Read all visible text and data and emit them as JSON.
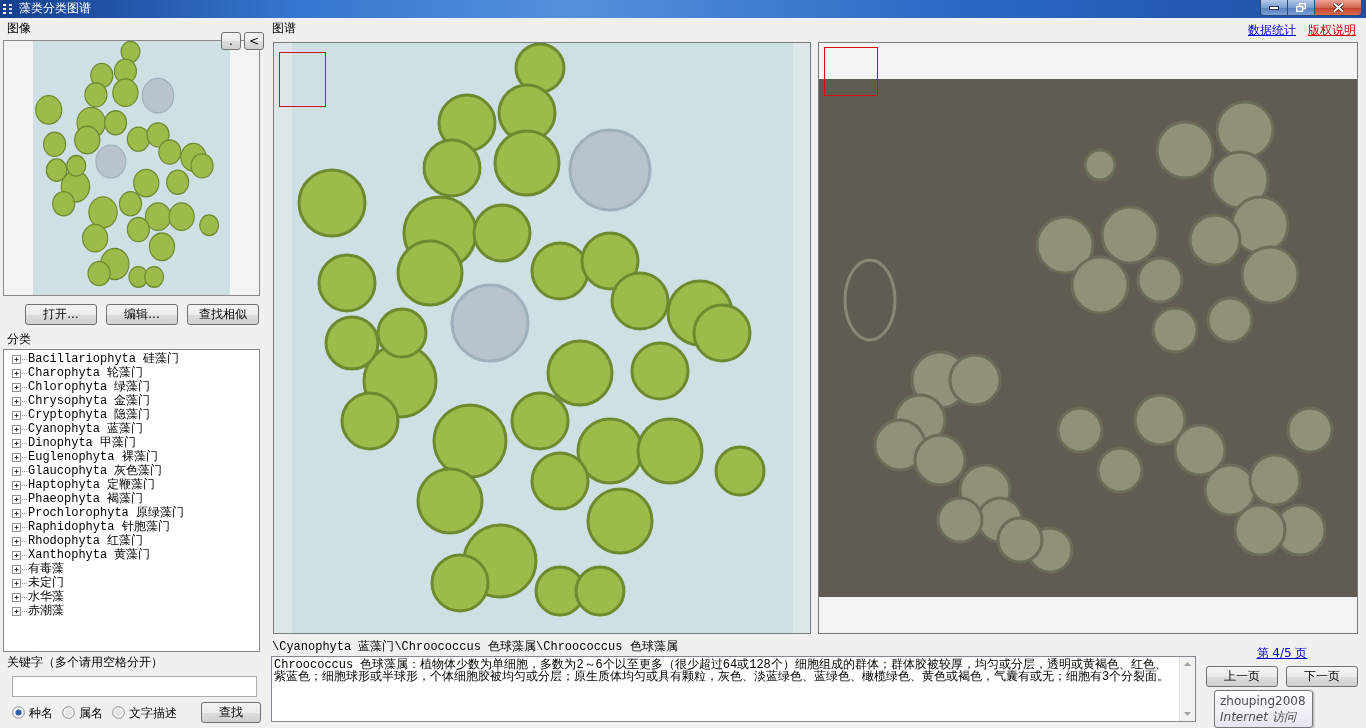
{
  "window": {
    "title": "藻类分类图谱"
  },
  "image_panel": {
    "label": "图像",
    "nav_buttons": [
      ".",
      "<"
    ],
    "actions": [
      "打开...",
      "编辑...",
      "查找相似"
    ]
  },
  "classification": {
    "label": "分类",
    "tree": [
      {
        "label": "Bacillariophyta 硅藻门",
        "expanded": false
      },
      {
        "label": "Charophyta 轮藻门",
        "expanded": false
      },
      {
        "label": "Chlorophyta 绿藻门",
        "expanded": false
      },
      {
        "label": "Chrysophyta 金藻门",
        "expanded": false
      },
      {
        "label": "Cryptophyta 隐藻门",
        "expanded": false
      },
      {
        "label": "Cyanophyta 蓝藻门",
        "expanded": false
      },
      {
        "label": "Dinophyta 甲藻门",
        "expanded": false
      },
      {
        "label": "Euglenophyta 裸藻门",
        "expanded": false
      },
      {
        "label": "Glaucophyta 灰色藻门",
        "expanded": false
      },
      {
        "label": "Haptophyta 定鞭藻门",
        "expanded": false
      },
      {
        "label": "Phaeophyta 褐藻门",
        "expanded": false
      },
      {
        "label": "Prochlorophyta 原绿藻门",
        "expanded": false
      },
      {
        "label": "Raphidophyta 针胞藻门",
        "expanded": false
      },
      {
        "label": "Rhodophyta 红藻门",
        "expanded": false
      },
      {
        "label": "Xanthophyta 黄藻门",
        "expanded": false
      },
      {
        "label": "有毒藻",
        "expanded": false
      },
      {
        "label": "未定门",
        "expanded": false
      },
      {
        "label": "水华藻",
        "expanded": false
      },
      {
        "label": "赤潮藻",
        "expanded": false
      }
    ]
  },
  "search": {
    "label": "关键字（多个请用空格分开）",
    "options": [
      {
        "label": "种名",
        "selected": true
      },
      {
        "label": "属名",
        "selected": false
      },
      {
        "label": "文字描述",
        "selected": false
      }
    ],
    "button": "查找"
  },
  "atlas": {
    "label": "图谱",
    "links": [
      {
        "label": "数据统计",
        "color": "#0000cc"
      },
      {
        "label": "版权说明",
        "color": "#cc0000"
      }
    ]
  },
  "info": {
    "path": "\\Cyanophyta 蓝藻门\\Chroococcus 色球藻属\\Chroococcus 色球藻属",
    "description": "Chroococcus 色球藻属：植物体少数为单细胞，多数为2～6个以至更多（很少超过64或128个）细胞组成的群体；群体胶被较厚，均匀或分层，透明或黄褐色、红色、紫蓝色；细胞球形或半球形，个体细胞胶被均匀或分层；原生质体均匀或具有颗粒，灰色、淡蓝绿色、蓝绿色、橄榄绿色、黄色或褐色，气囊有或无；细胞有3个分裂面。",
    "page": "第 4/5 页",
    "prev": "上一页",
    "next": "下一页"
  },
  "tooltip": {
    "title": "zhouping2008",
    "subtitle": "Internet 访问"
  }
}
